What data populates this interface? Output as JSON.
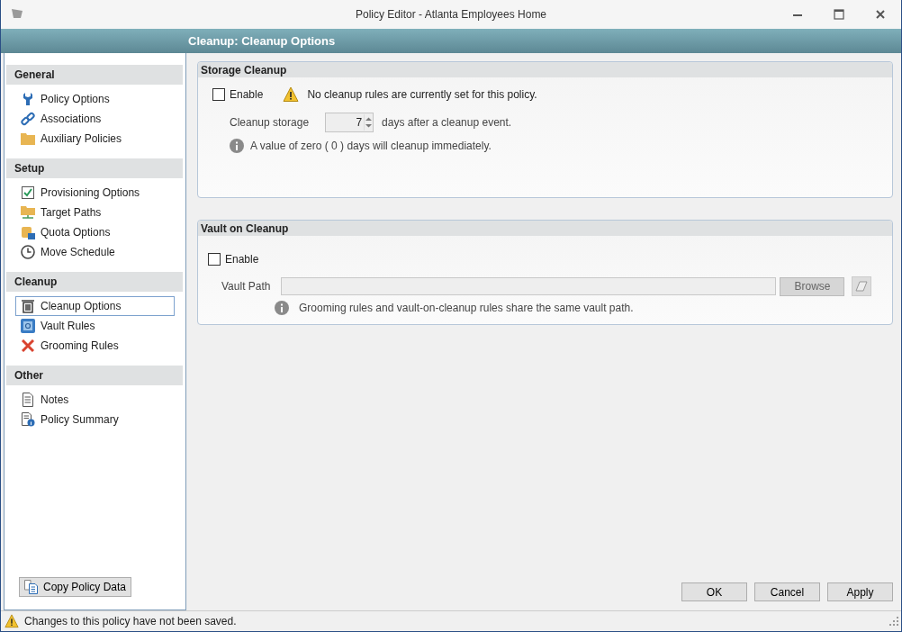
{
  "window": {
    "title": "Policy Editor - Atlanta Employees Home"
  },
  "header": {
    "title": "Cleanup: Cleanup Options"
  },
  "sidebar": {
    "groups": [
      {
        "title": "General",
        "items": [
          {
            "label": "Policy Options",
            "selected": false
          },
          {
            "label": "Associations",
            "selected": false
          },
          {
            "label": "Auxiliary Policies",
            "selected": false
          }
        ]
      },
      {
        "title": "Setup",
        "items": [
          {
            "label": "Provisioning Options",
            "selected": false
          },
          {
            "label": "Target Paths",
            "selected": false
          },
          {
            "label": "Quota Options",
            "selected": false
          },
          {
            "label": "Move Schedule",
            "selected": false
          }
        ]
      },
      {
        "title": "Cleanup",
        "items": [
          {
            "label": "Cleanup Options",
            "selected": true
          },
          {
            "label": "Vault Rules",
            "selected": false
          },
          {
            "label": "Grooming Rules",
            "selected": false
          }
        ]
      },
      {
        "title": "Other",
        "items": [
          {
            "label": "Notes",
            "selected": false
          },
          {
            "label": "Policy Summary",
            "selected": false
          }
        ]
      }
    ],
    "copy_button": "Copy Policy Data"
  },
  "storage_cleanup": {
    "title": "Storage Cleanup",
    "enable": {
      "label": "Enable",
      "checked": false
    },
    "warning": "No cleanup rules are currently set for this policy.",
    "storage_label": "Cleanup storage",
    "days_value": "7",
    "days_suffix": "days after a cleanup event.",
    "info": "A value of zero ( 0 ) days will cleanup immediately."
  },
  "vault_on_cleanup": {
    "title": "Vault on Cleanup",
    "enable": {
      "label": "Enable",
      "checked": false
    },
    "path_label": "Vault Path",
    "browse_button": "Browse",
    "info": "Grooming rules and vault-on-cleanup rules share the same vault path."
  },
  "buttons": [
    "OK",
    "Cancel",
    "Apply"
  ],
  "status_bar": "Changes to this policy have not been saved."
}
